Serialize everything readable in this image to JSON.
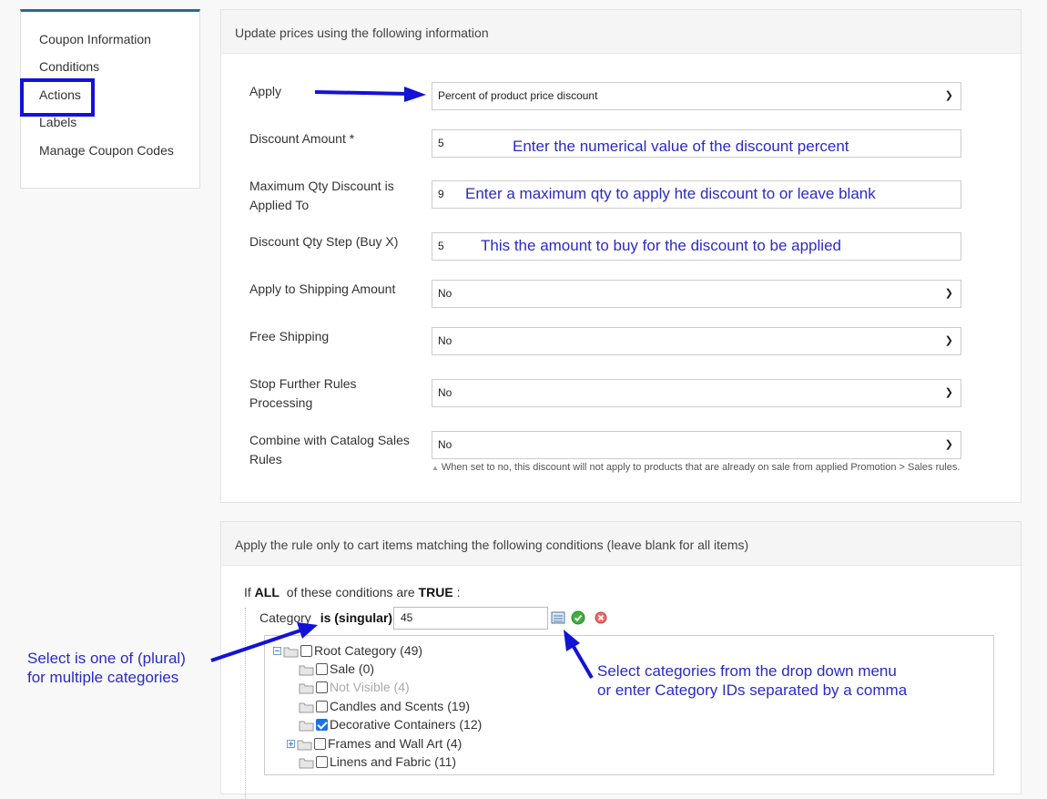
{
  "sidebar": {
    "items": [
      {
        "label": "Coupon Information"
      },
      {
        "label": "Conditions"
      },
      {
        "label": "Actions"
      },
      {
        "label": "Labels"
      },
      {
        "label": "Manage Coupon Codes"
      }
    ]
  },
  "actions_panel": {
    "header": "Update prices using the following information",
    "apply": {
      "label": "Apply",
      "value": "Percent of product price discount"
    },
    "discount_amount": {
      "label": "Discount Amount *",
      "value": "5",
      "note": "Enter the numerical value of the discount percent"
    },
    "max_qty": {
      "label": "Maximum Qty Discount is Applied To",
      "value": "9",
      "note": "Enter a maximum qty to apply hte discount to or leave blank"
    },
    "qty_step": {
      "label": "Discount Qty Step (Buy X)",
      "value": "5",
      "note": "This the amount to buy for the discount to be applied"
    },
    "apply_shipping": {
      "label": "Apply to Shipping Amount",
      "value": "No"
    },
    "free_shipping": {
      "label": "Free Shipping",
      "value": "No"
    },
    "stop_rules": {
      "label": "Stop Further Rules Processing",
      "value": "No"
    },
    "combine_catalog": {
      "label": "Combine with Catalog Sales Rules",
      "value": "No",
      "hint": "When set to no, this discount will not apply to products that are already on sale from applied Promotion > Sales rules."
    }
  },
  "conditions_panel": {
    "header": "Apply the rule only to cart items matching the following conditions (leave blank for all items)",
    "if_text": "If",
    "all_text": "ALL",
    "of_these": "of these conditions are",
    "true_text": "TRUE",
    "colon": ":",
    "category_label": "Category",
    "operator": "is (singular)",
    "category_value": "45",
    "tree": [
      {
        "label": "Root Category (49)",
        "checked": false,
        "muted": false
      },
      {
        "label": "Sale (0)",
        "checked": false,
        "muted": false
      },
      {
        "label": "Not Visible (4)",
        "checked": false,
        "muted": true
      },
      {
        "label": "Candles and Scents (19)",
        "checked": false,
        "muted": false
      },
      {
        "label": "Decorative Containers (12)",
        "checked": true,
        "muted": false
      },
      {
        "label": "Frames and Wall Art (4)",
        "checked": false,
        "muted": false
      },
      {
        "label": "Linens and Fabric (11)",
        "checked": false,
        "muted": false
      }
    ]
  },
  "annotations": {
    "plural_note_1": "Select is one of (plural)",
    "plural_note_2": "for multiple categories",
    "categories_note_1": "Select categories from the drop down menu",
    "categories_note_2": "or enter Category IDs separated by a comma"
  },
  "colors": {
    "annotation_blue": "#2a2ac8",
    "highlight_box": "#1212d8",
    "sidebar_accent": "#2b6a8f"
  }
}
